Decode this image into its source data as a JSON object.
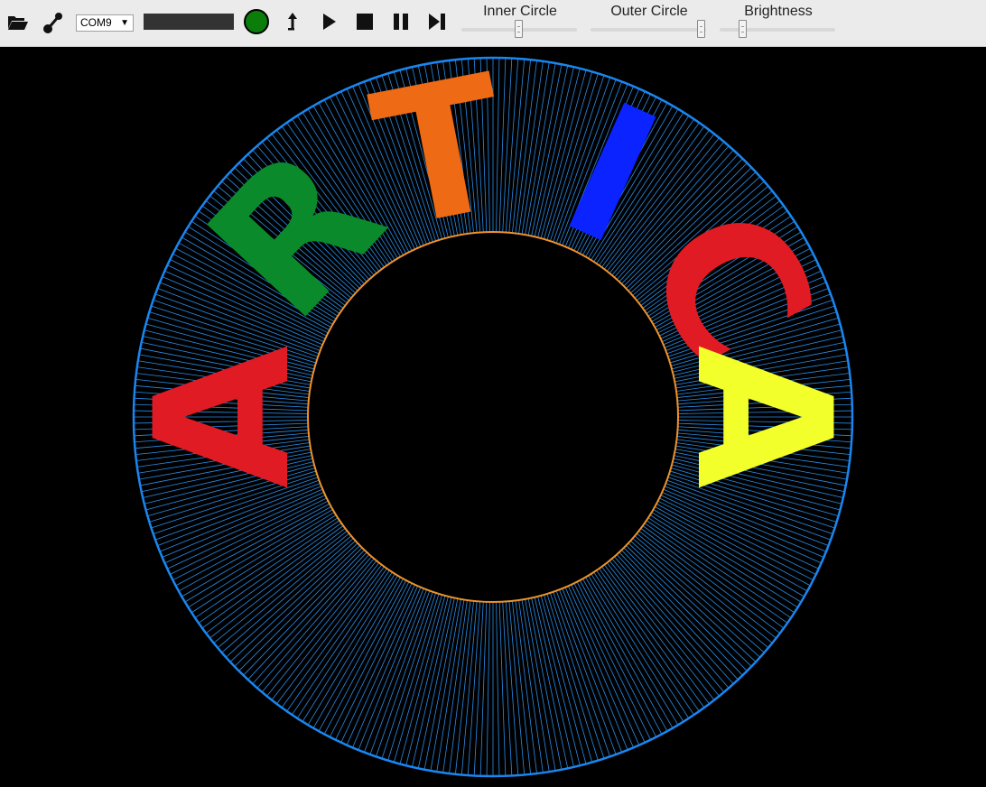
{
  "toolbar": {
    "open_icon": "folder-open-icon",
    "connect_icon": "connect-link-icon",
    "port": {
      "selected": "COM9"
    },
    "status_color": "#0a7d0a",
    "actions": [
      {
        "name": "upload-button",
        "icon": "upload-arrow-icon"
      },
      {
        "name": "play-button",
        "icon": "play-icon"
      },
      {
        "name": "stop-button",
        "icon": "stop-icon"
      },
      {
        "name": "pause-button",
        "icon": "pause-icon"
      },
      {
        "name": "step-forward-button",
        "icon": "step-forward-icon"
      }
    ],
    "sliders": [
      {
        "id": "inner",
        "label": "Inner Circle",
        "value": 0.5
      },
      {
        "id": "outer",
        "label": "Outer Circle",
        "value": 0.96
      },
      {
        "id": "brightness",
        "label": "Brightness",
        "value": 0.2
      }
    ]
  },
  "canvas": {
    "background": "#000000",
    "outer_circle_color": "#1a86f0",
    "inner_circle_color": "#f0922a",
    "spoke_color": "#2a8de6",
    "spoke_count": 360,
    "text": "ARTICA",
    "letter_colors": [
      "#e01b24",
      "#0a8a2a",
      "#ee6a14",
      "#0a23ff",
      "#e01b24",
      "#f2ff2a"
    ]
  }
}
